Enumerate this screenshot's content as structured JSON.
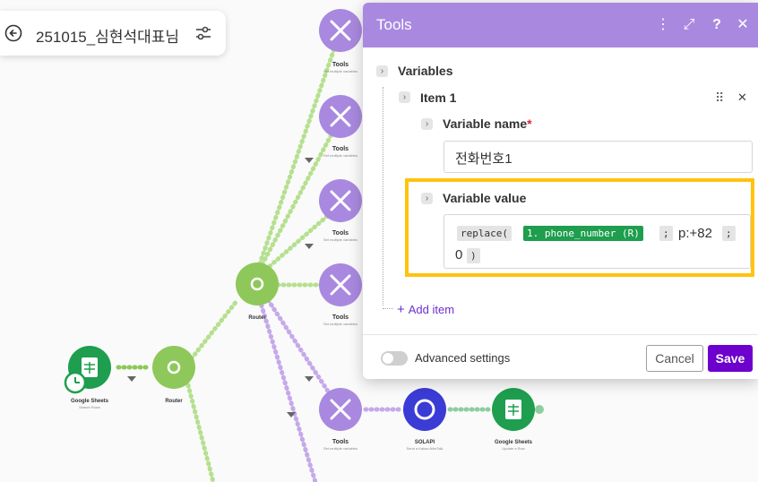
{
  "scenario": {
    "title": "251015_심현석대표님"
  },
  "modules": {
    "tools_1": {
      "name": "Tools",
      "sub": "Set multiple variables"
    },
    "tools_2": {
      "name": "Tools",
      "sub": "Set multiple variables"
    },
    "tools_3": {
      "name": "Tools",
      "sub": "Set multiple variables"
    },
    "tools_4": {
      "name": "Tools",
      "sub": "Set multiple variables"
    },
    "tools_5": {
      "name": "Tools",
      "sub": "Set multiple variables"
    },
    "router_main": {
      "name": "Router"
    },
    "router_left": {
      "name": "Router"
    },
    "sheets_left": {
      "name": "Google Sheets",
      "sub": "Search Rows"
    },
    "solapi": {
      "name": "SOLAPI",
      "sub": "Send a Kakao AlimTalk"
    },
    "sheets_right": {
      "name": "Google Sheets",
      "sub": "Update a Row"
    }
  },
  "panel": {
    "title": "Tools",
    "section_label": "Variables",
    "item_label": "Item 1",
    "var_name_label": "Variable name",
    "required_mark": "*",
    "var_name_value": "전화번호1",
    "var_value_label": "Variable value",
    "formula": {
      "fn": "replace(",
      "mapped": "1. phone_number (R)",
      "sep1": ";",
      "text1": "p:+82",
      "sep2": ";",
      "text2": "0",
      "close": ")"
    },
    "add_item_label": "Add item",
    "advanced_label": "Advanced settings",
    "cancel_label": "Cancel",
    "save_label": "Save"
  },
  "colors": {
    "tools": "#a989df",
    "router": "#8ec85a",
    "sheets": "#1e9e4e",
    "solapi": "#3b3bd6",
    "highlight": "#ffc20e",
    "save": "#6d00cc",
    "link_text": "#6d2fd1"
  },
  "icons": {
    "back": "back-arrow-icon",
    "tune": "tune-icon",
    "more": "more-vertical-icon",
    "expand": "expand-icon",
    "help": "help-icon",
    "close": "close-icon",
    "drag": "drag-handle-icon",
    "plus": "plus-icon"
  }
}
